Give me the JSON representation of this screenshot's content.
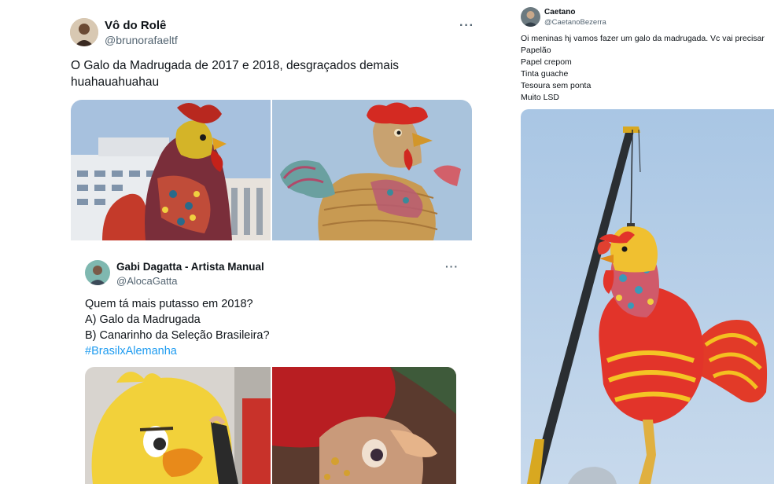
{
  "tweet1": {
    "name": "Vô do Rolê",
    "handle": "@brunorafaeltf",
    "more": "···",
    "text_line1": "O Galo da Madrugada de 2017 e 2018, desgraçados demais",
    "text_line2": "huahauahuahau"
  },
  "quote": {
    "name": "Gabi Dagatta - Artista Manual",
    "handle": "@AlocaGatta",
    "more": "···",
    "line1": "Quem tá mais putasso em 2018?",
    "line2": "A) Galo da Madrugada",
    "line3": "B) Canarinho da Seleção Brasileira?",
    "hashtag": "#BrasilxAlemanha"
  },
  "tweet2": {
    "name": "Caetano",
    "handle": "@CaetanoBezerra",
    "lines": [
      "Oi meninas hj vamos fazer um galo da madrugada. Vc vai precisar",
      "Papelão",
      "Papel crepom",
      "Tinta guache",
      "Tesoura sem ponta",
      "Muito LSD"
    ]
  },
  "colors": {
    "link": "#1d9bf0",
    "text": "#0f1419",
    "secondary": "#536471",
    "sky": "#9ebfe0"
  }
}
